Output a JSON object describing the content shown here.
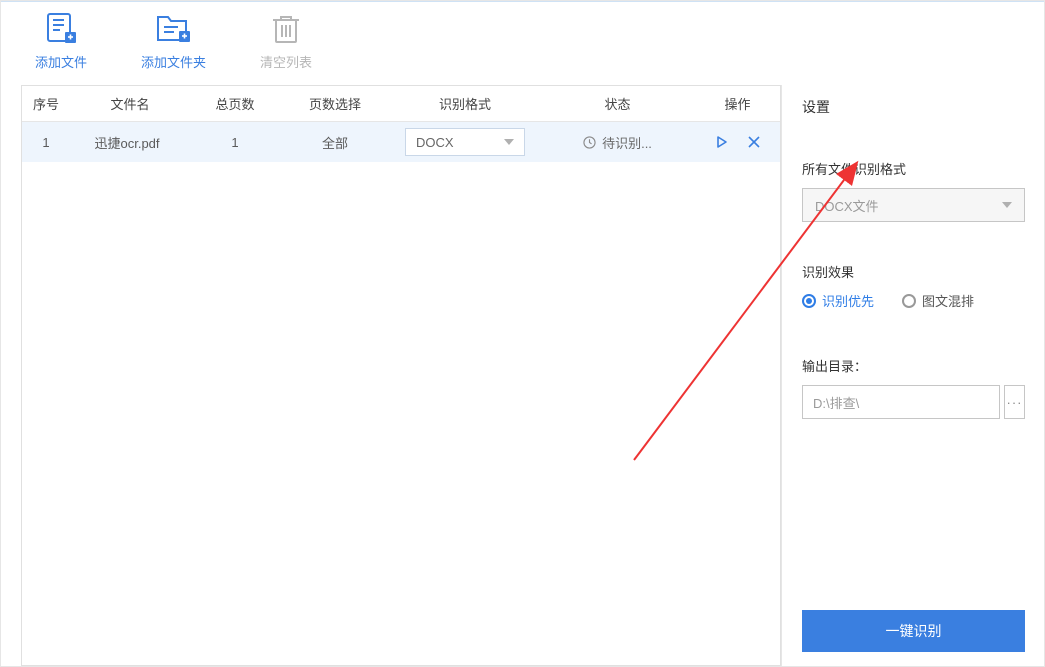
{
  "toolbar": {
    "add_file": "添加文件",
    "add_folder": "添加文件夹",
    "clear_list": "清空列表"
  },
  "table": {
    "headers": {
      "index": "序号",
      "filename": "文件名",
      "total_pages": "总页数",
      "page_select": "页数选择",
      "format": "识别格式",
      "status": "状态",
      "action": "操作"
    },
    "rows": [
      {
        "index": "1",
        "filename": "迅捷ocr.pdf",
        "total_pages": "1",
        "page_select": "全部",
        "format": "DOCX",
        "status": "待识别..."
      }
    ]
  },
  "settings": {
    "title": "设置",
    "format_label": "所有文件识别格式",
    "format_value": "DOCX文件",
    "effect_label": "识别效果",
    "effect_priority": "识别优先",
    "effect_mixed": "图文混排",
    "output_label": "输出目录：",
    "output_value": "D:\\排查\\",
    "browse": "···",
    "primary_button": "一键识别"
  }
}
